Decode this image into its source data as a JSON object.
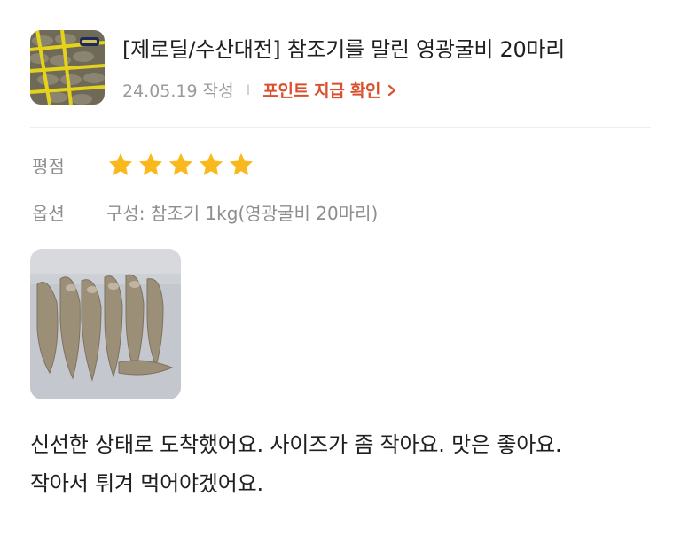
{
  "product": {
    "title": "[제로딜/수산대전] 참조기를 말린 영광굴비 20마리",
    "date": "24.05.19 작성",
    "separator": "I",
    "point_link": "포인트 지급 확인"
  },
  "review": {
    "rating_label": "평점",
    "rating": 5,
    "rating_max": 5,
    "option_label": "옵션",
    "option_value": "구성: 참조기 1kg(영광굴비 20마리)",
    "text_line1": "신선한 상태로 도착했어요. 사이즈가 좀 작아요. 맛은 좋아요.",
    "text_line2": "작아서 튀겨 먹어야겠어요."
  },
  "colors": {
    "star": "#f9b81b",
    "accent": "#d9502e",
    "muted": "#8e8e8e"
  },
  "icons": {
    "point_chevron": "chevron-right-icon",
    "star": "star-icon"
  }
}
